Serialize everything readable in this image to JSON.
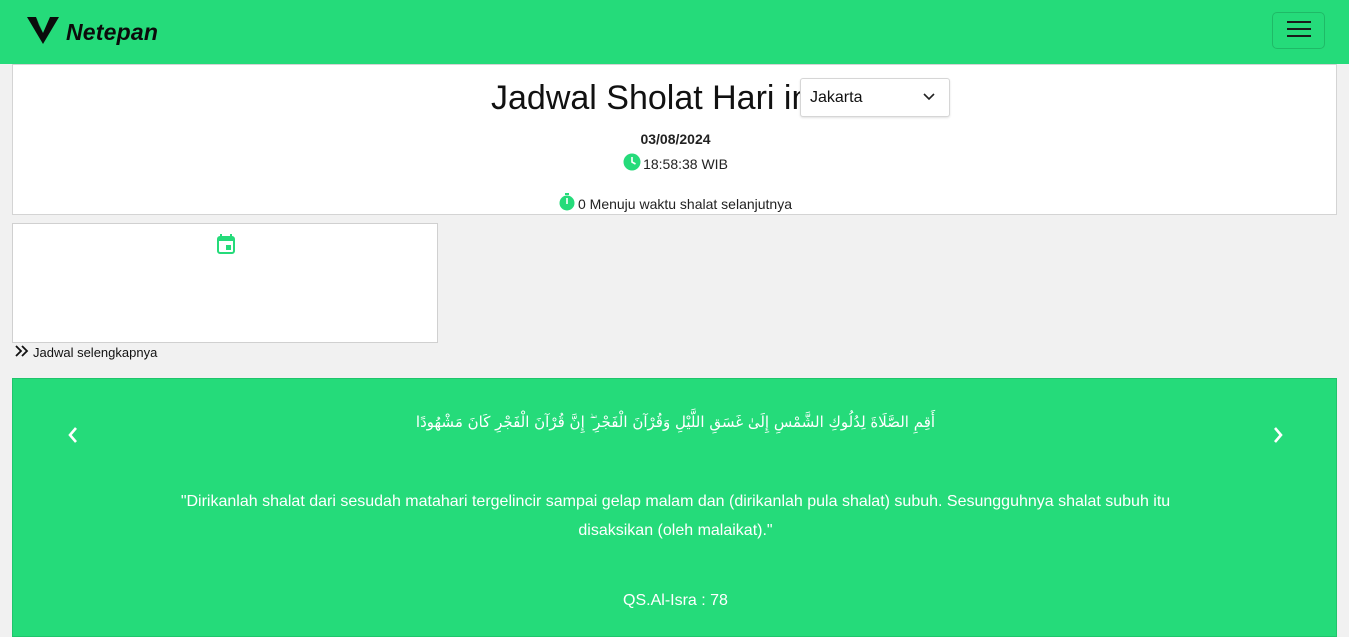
{
  "navbar": {
    "brand": "Netepan",
    "logo_icon": "netepan-logo-icon",
    "menu_icon": "hamburger-menu-icon",
    "accent_color": "#25db7a"
  },
  "header": {
    "title": "Jadwal Sholat Hari ini",
    "city_selected": "Jakarta",
    "date": "03/08/2024",
    "time": "18:58:38 WIB",
    "next_prayer_text": "0 Menuju waktu shalat selanjutnya"
  },
  "schedule": {
    "calendar_icon": "calendar-icon",
    "more_link": "Jadwal selengkapnya"
  },
  "verse_carousel": {
    "arabic": "أَقِمِ الصَّلَاةَ لِدُلُوكِ الشَّمْسِ إِلَىٰ غَسَقِ اللَّيْلِ وَقُرْآنَ الْفَجْرِ ۖ إِنَّ قُرْآنَ الْفَجْرِ كَانَ مَشْهُودًا",
    "translation": "\"Dirikanlah shalat dari sesudah matahari tergelincir sampai gelap malam dan (dirikanlah pula shalat) subuh. Sesungguhnya shalat subuh itu disaksikan (oleh malaikat).\"",
    "reference": "QS.Al-Isra : 78"
  }
}
